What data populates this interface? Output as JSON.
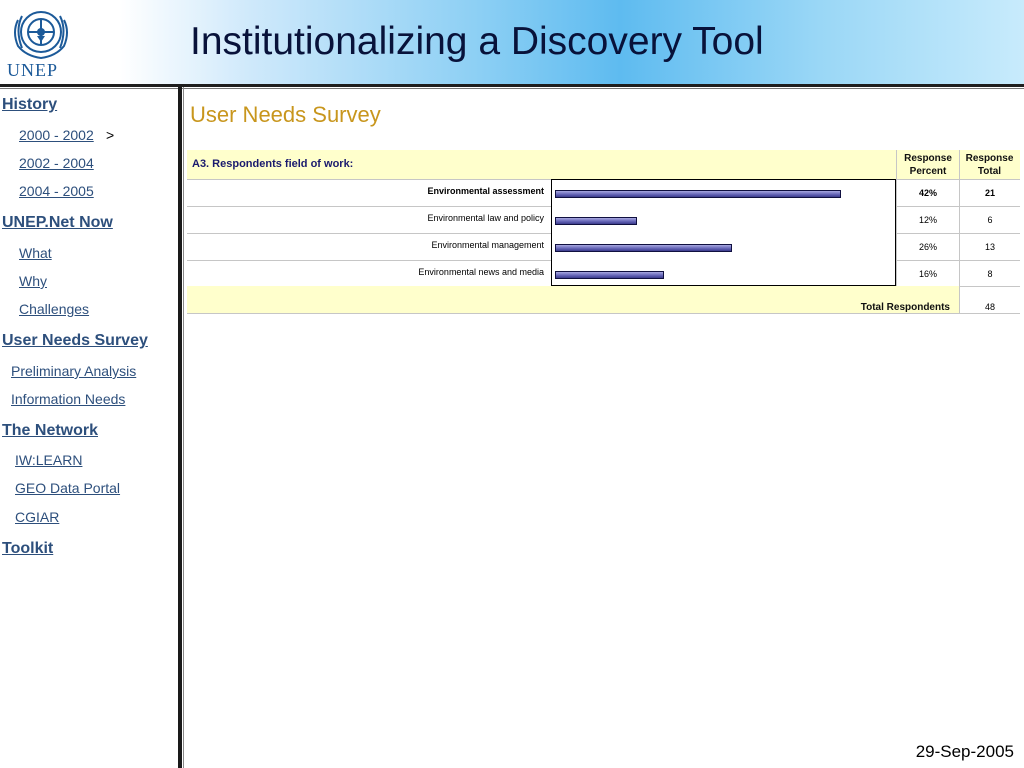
{
  "header": {
    "logo_text": "UNEP",
    "title": "Institutionalizing a Discovery Tool"
  },
  "sidebar": {
    "items": [
      {
        "label": "History",
        "level": 0
      },
      {
        "label": "2000 -  2002",
        "suffix": ">",
        "level": 1
      },
      {
        "label": "2002 -  2004",
        "level": 1
      },
      {
        "label": "2004 - 2005",
        "level": 1
      },
      {
        "label": "UNEP.Net Now",
        "level": 0
      },
      {
        "label": "What",
        "level": 1
      },
      {
        "label": "Why",
        "level": 1
      },
      {
        "label": "Challenges",
        "level": 1
      },
      {
        "label": "User Needs Survey",
        "level": 0
      },
      {
        "label": "Preliminary Analysis",
        "level": 1
      },
      {
        "label": "Information Needs",
        "level": 1
      },
      {
        "label": "The Network",
        "level": 0
      },
      {
        "label": "IW:LEARN",
        "level": 1
      },
      {
        "label": "GEO Data Portal",
        "level": 1
      },
      {
        "label": "CGIAR",
        "level": 1
      },
      {
        "label": "Toolkit",
        "level": 0
      }
    ]
  },
  "content": {
    "title": "User Needs Survey"
  },
  "survey": {
    "question": "A3. Respondents field of work:",
    "col_percent": "Response Percent",
    "col_total": "Response Total",
    "total_label": "Total Respondents",
    "total_value": "48"
  },
  "chart_data": {
    "type": "bar",
    "orientation": "horizontal",
    "title": "A3. Respondents field of work:",
    "categories": [
      "Environmental assessment",
      "Environmental law and policy",
      "Environmental management",
      "Environmental news and media"
    ],
    "values": [
      42,
      12,
      26,
      16
    ],
    "percent_labels": [
      "42%",
      "12%",
      "26%",
      "16%"
    ],
    "totals": [
      21,
      6,
      13,
      8
    ],
    "bold_rows": [
      true,
      false,
      false,
      false
    ],
    "ylim": [
      0,
      50
    ]
  },
  "footer": {
    "date": "29-Sep-2005"
  },
  "colors": {
    "nav_link": "#2d4f7c",
    "content_title": "#c8961d",
    "table_header_bg": "#ffffcc",
    "bar_fill": "#6161b4"
  }
}
